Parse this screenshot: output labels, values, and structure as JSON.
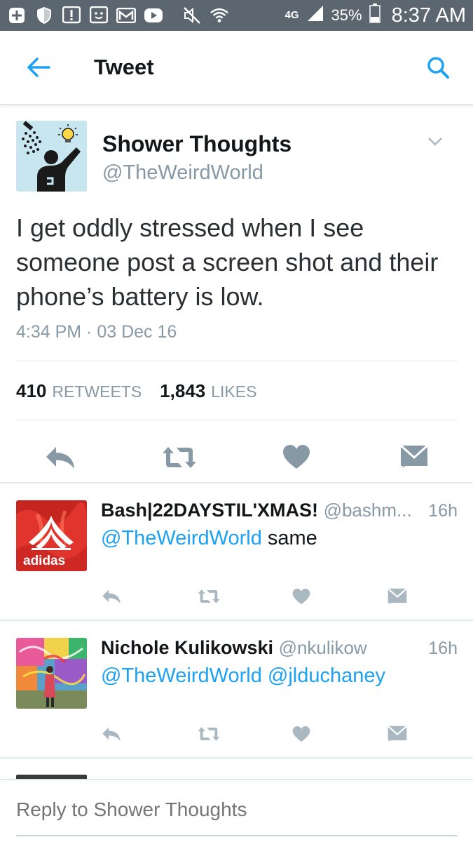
{
  "status_bar": {
    "icons": [
      "plus-icon",
      "shield-icon",
      "alert-icon",
      "face-icon",
      "mail-icon",
      "play-icon",
      "mute-icon",
      "wifi-icon"
    ],
    "network": "4G",
    "battery_percent": "35%",
    "time": "8:37 AM"
  },
  "toolbar": {
    "title": "Tweet"
  },
  "tweet": {
    "author_name": "Shower Thoughts",
    "author_handle": "@TheWeirdWorld",
    "text": "I get oddly stressed when I see someone post a screen shot and their phone’s battery is low.",
    "timestamp": "4:34 PM · 03 Dec 16",
    "retweets_count": "410",
    "retweets_label": "RETWEETS",
    "likes_count": "1,843",
    "likes_label": "LIKES"
  },
  "replies": [
    {
      "name": "Bash|22DAYSTIL'XMAS!",
      "handle": "@bashm...",
      "age": "16h",
      "mentions": "@TheWeirdWorld",
      "text": "same",
      "avatar_text": "adidas"
    },
    {
      "name": "Nichole Kulikowski",
      "handle": "@nkulikow",
      "age": "16h",
      "mentions": "@TheWeirdWorld @jlduchaney",
      "text": ""
    }
  ],
  "composer": {
    "placeholder": "Reply to Shower Thoughts"
  },
  "colors": {
    "accent": "#1da1f2",
    "status_bar": "#5b6670",
    "muted": "#8899a6",
    "icon_gray": "#8899a6"
  }
}
